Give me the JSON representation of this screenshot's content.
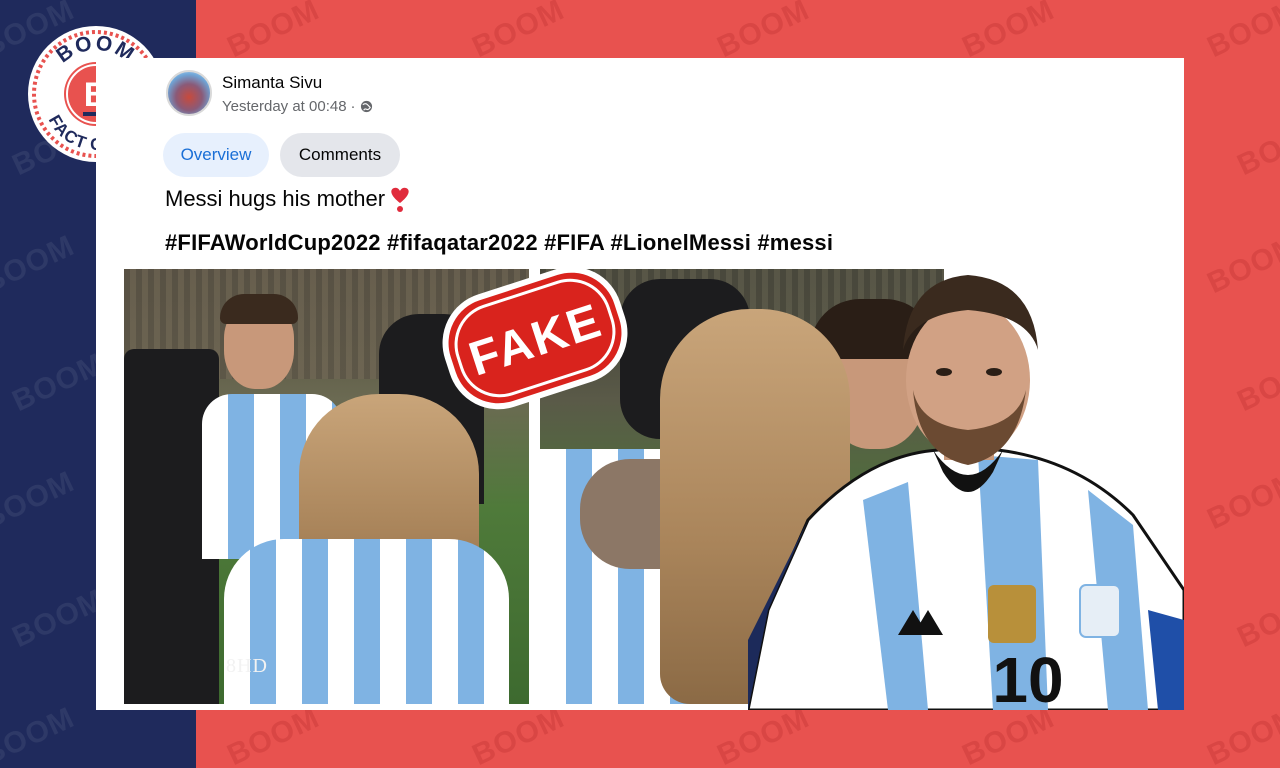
{
  "logo": {
    "top_text": "BOOM",
    "letter": "B",
    "bottom_text": "FACT CHECK",
    "color": "#e8524f"
  },
  "watermark": "BOOM",
  "post": {
    "author": "Simanta Sivu",
    "timestamp": "Yesterday at 00:48",
    "separator": "·",
    "privacy_icon": "globe-icon",
    "tabs": [
      {
        "label": "Overview",
        "active": true
      },
      {
        "label": "Comments",
        "active": false
      }
    ],
    "caption": "Messi hugs his mother",
    "caption_emoji": "heart-exclamation",
    "hashtags": "#FIFAWorldCup2022 #fifaqatar2022 #FIFA #LionelMessi #messi"
  },
  "video": {
    "watermark": "8HD"
  },
  "stamp": {
    "text": "FAKE",
    "color": "#d9231d"
  },
  "jersey": {
    "number": "10"
  },
  "colors": {
    "navy": "#1f2a5c",
    "red": "#e8524f",
    "link_blue": "#1a6fd6",
    "argentina_blue": "#7fb3e3"
  }
}
